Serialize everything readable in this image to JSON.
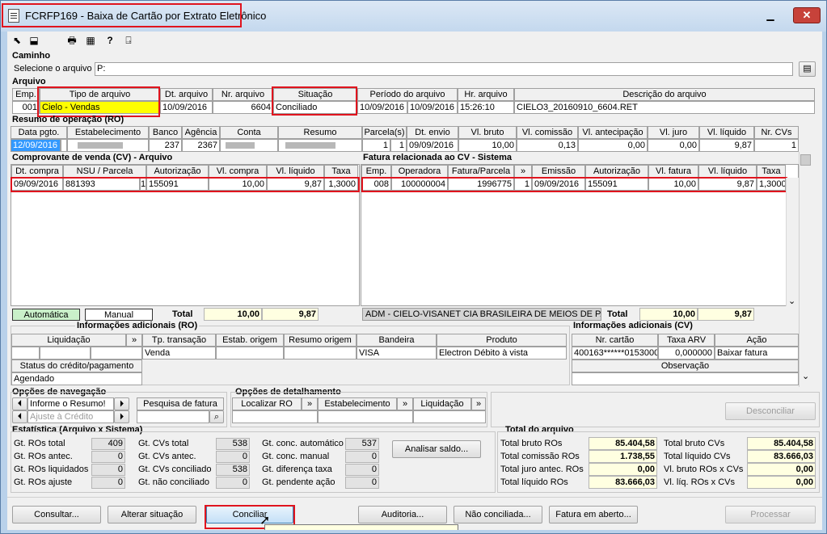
{
  "window": {
    "title": "FCRFP169 - Baixa de Cartão por Extrato Eletrônico",
    "minimize": "▁",
    "close": "✕"
  },
  "sections": {
    "caminho": "Caminho",
    "arquivo": "Arquivo",
    "resumo": "Resumo de operação (RO)",
    "cv": "Comprovante de venda (CV) - Arquivo",
    "fatura": "Fatura relacionada ao CV - Sistema",
    "info_ro": "Informações adicionais (RO)",
    "info_cv": "Informações adicionais (CV)",
    "navegacao": "Opções de navegação",
    "detalhamento": "Opções de detalhamento",
    "estatistica": "Estatística (Arquivo x Sistema)",
    "total_arquivo": "Total do arquivo"
  },
  "caminho": {
    "label": "Selecione o arquivo",
    "value": "P:"
  },
  "arquivo": {
    "headers": [
      "Emp.",
      "Tipo de arquivo",
      "Dt. arquivo",
      "Nr. arquivo",
      "Situação",
      "Período do arquivo",
      "Hr. arquivo",
      "Descrição do arquivo"
    ],
    "row": {
      "emp": "001",
      "tipo": "Cielo - Vendas",
      "dt": "10/09/2016",
      "nr": "6604",
      "situacao": "Conciliado",
      "periodo_ini": "10/09/2016",
      "periodo_fim": "10/09/2016",
      "hr": "15:26:10",
      "descricao": "CIELO3_20160910_6604.RET"
    }
  },
  "resumo": {
    "headers": [
      "Data pgto.",
      "Estabelecimento",
      "Banco",
      "Agência",
      "Conta",
      "Resumo",
      "Parcela(s)",
      "Dt. envio",
      "Vl. bruto",
      "Vl. comissão",
      "Vl. antecipação",
      "Vl. juro",
      "Vl. líquido",
      "Nr. CVs"
    ],
    "row": {
      "data": "12/09/2016",
      "banco": "237",
      "agencia": "2367",
      "parcela_a": "1",
      "parcela_b": "1",
      "dt_envio": "09/09/2016",
      "bruto": "10,00",
      "comissao": "0,13",
      "antecipacao": "0,00",
      "juro": "0,00",
      "liquido": "9,87",
      "nr_cvs": "1"
    }
  },
  "cv": {
    "headers": [
      "Dt. compra",
      "NSU / Parcela",
      "Autorização",
      "Vl. compra",
      "Vl. líquido",
      "Taxa"
    ],
    "row": {
      "dt": "09/09/2016",
      "nsu": "881393",
      "parcela": "1",
      "autorizacao": "155091",
      "compra": "10,00",
      "liquido": "9,87",
      "taxa": "1,3000"
    },
    "automatica": "Automática",
    "manual": "Manual",
    "total_label": "Total",
    "total_compra": "10,00",
    "total_liquido": "9,87"
  },
  "fatura": {
    "headers": [
      "Emp.",
      "Operadora",
      "Fatura/Parcela",
      "»",
      "Emissão",
      "Autorização",
      "Vl. fatura",
      "Vl. líquido",
      "Taxa"
    ],
    "row": {
      "emp": "008",
      "operadora": "100000004",
      "fatura": "1996775",
      "parcela": "1",
      "emissao": "09/09/2016",
      "autorizacao": "155091",
      "vl_fatura": "10,00",
      "liquido": "9,87",
      "taxa": "1,3000"
    },
    "operadora_nome": "ADM - CIELO-VISANET CIA BRASILEIRA DE MEIOS DE PAGAI",
    "total_label": "Total",
    "total_fatura": "10,00",
    "total_liquido": "9,87"
  },
  "info_ro": {
    "headers": [
      "Liquidação",
      "»",
      "Tp. transação",
      "Estab. origem",
      "Resumo origem",
      "Bandeira",
      "Produto"
    ],
    "row": {
      "tp": "Venda",
      "bandeira": "VISA",
      "produto": "Electron Débito à vista"
    },
    "status_header": "Status do crédito/pagamento",
    "status": "Agendado"
  },
  "info_cv": {
    "headers": [
      "Nr. cartão",
      "Taxa ARV",
      "Ação"
    ],
    "row": {
      "cartao": "400163******0153000",
      "taxa": "0,000000",
      "acao": "Baixar fatura"
    },
    "obs_header": "Observação"
  },
  "navegacao": {
    "informe": "Informe o Resumo!",
    "ajuste": "Ajuste à Crédito",
    "pesquisa": "Pesquisa de fatura"
  },
  "detalhamento": {
    "headers": [
      "Localizar RO",
      "»",
      "Estabelecimento",
      "»",
      "Liquidação",
      "»"
    ]
  },
  "desconciliar": "Desconciliar",
  "estatistica": {
    "col1": [
      {
        "label": "Gt. ROs total",
        "value": "409"
      },
      {
        "label": "Gt. ROs antec.",
        "value": "0"
      },
      {
        "label": "Gt. ROs liquidados",
        "value": "0"
      },
      {
        "label": "Gt. ROs ajuste",
        "value": "0"
      }
    ],
    "col2": [
      {
        "label": "Gt. CVs total",
        "value": "538"
      },
      {
        "label": "Gt. CVs antec.",
        "value": "0"
      },
      {
        "label": "Gt. CVs conciliado",
        "value": "538"
      },
      {
        "label": "Gt. não conciliado",
        "value": "0"
      }
    ],
    "col3": [
      {
        "label": "Gt. conc. automático",
        "value": "537"
      },
      {
        "label": "Gt. conc. manual",
        "value": "0"
      },
      {
        "label": "Gt. diferença taxa",
        "value": "0"
      },
      {
        "label": "Gt. pendente ação",
        "value": "0"
      }
    ],
    "analisar": "Analisar saldo..."
  },
  "total_arquivo": {
    "left": [
      {
        "label": "Total bruto ROs",
        "value": "85.404,58"
      },
      {
        "label": "Total comissão ROs",
        "value": "1.738,55"
      },
      {
        "label": "Total juro antec. ROs",
        "value": "0,00"
      },
      {
        "label": "Total líquido ROs",
        "value": "83.666,03"
      }
    ],
    "right": [
      {
        "label": "Total bruto CVs",
        "value": "85.404,58"
      },
      {
        "label": "Total líquido CVs",
        "value": "83.666,03"
      },
      {
        "label": "Vl. bruto ROs x CVs",
        "value": "0,00"
      },
      {
        "label": "Vl. líq. ROs x CVs",
        "value": "0,00"
      }
    ]
  },
  "buttons": {
    "consultar": "Consultar...",
    "alterar": "Alterar situação",
    "conciliar": "Conciliar",
    "auditoria": "Auditoria...",
    "nao_conciliada": "Não conciliada...",
    "fatura_aberto": "Fatura em aberto...",
    "processar": "Processar"
  }
}
